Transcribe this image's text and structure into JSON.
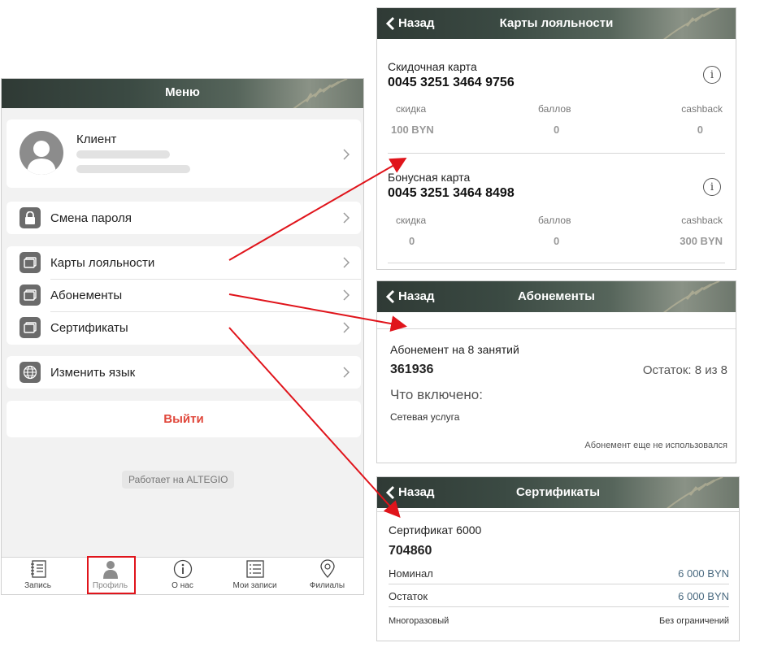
{
  "menu": {
    "title": "Меню",
    "profile": {
      "name": "Клиент"
    },
    "items": [
      {
        "label": "Смена пароля"
      },
      {
        "label": "Карты лояльности"
      },
      {
        "label": "Абонементы"
      },
      {
        "label": "Сертификаты"
      },
      {
        "label": "Изменить язык"
      }
    ],
    "logout": "Выйти",
    "powered": "Работает на ALTEGIO",
    "tabs": [
      "Запись",
      "Профиль",
      "О нас",
      "Мои записи",
      "Филиалы"
    ]
  },
  "loyalty": {
    "back": "Назад",
    "title": "Карты лояльности",
    "cards": [
      {
        "type": "Скидочная карта",
        "number": "0045 3251 3464 9756",
        "discount_label": "скидка",
        "points_label": "баллов",
        "cashback_label": "cashback",
        "discount": "100 BYN",
        "points": "0",
        "cashback": "0"
      },
      {
        "type": "Бонусная карта",
        "number": "0045 3251 3464 8498",
        "discount_label": "скидка",
        "points_label": "баллов",
        "cashback_label": "cashback",
        "discount": "0",
        "points": "0",
        "cashback": "300 BYN"
      }
    ]
  },
  "subscriptions": {
    "back": "Назад",
    "title": "Абонементы",
    "name": "Абонемент на 8 занятий",
    "number": "361936",
    "remaining": "Остаток: 8 из 8",
    "included_title": "Что включено:",
    "service": "Сетевая услуга",
    "status": "Абонемент еще не использовался"
  },
  "certificates": {
    "back": "Назад",
    "title": "Сертификаты",
    "name": "Сертификат 6000",
    "number": "704860",
    "nominal_label": "Номинал",
    "nominal_value": "6 000 BYN",
    "balance_label": "Остаток",
    "balance_value": "6 000 BYN",
    "reusable": "Многоразовый",
    "limit": "Без ограничений"
  },
  "colors": {
    "logout": "#e0473b",
    "value_blue": "#4a6a80",
    "arrow": "#e0141b",
    "highlight": "#e0141b"
  }
}
